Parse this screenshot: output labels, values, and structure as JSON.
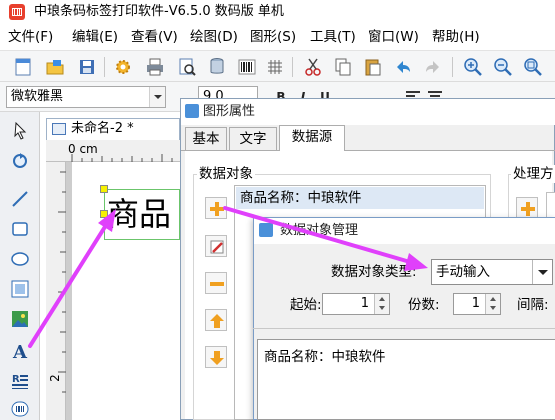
{
  "window": {
    "title": "中琅条码标签打印软件-V6.5.0 数码版 单机"
  },
  "menu": [
    "文件(F)",
    "编辑(E)",
    "查看(V)",
    "绘图(D)",
    "图形(S)",
    "工具(T)",
    "窗口(W)",
    "帮助(H)"
  ],
  "toolbar": {
    "icons": [
      "new-icon",
      "open-icon",
      "save-icon",
      "settings-icon",
      "print-icon",
      "print-preview-icon",
      "database-icon",
      "barcode-icon",
      "grid-icon",
      "cut-icon",
      "copy-icon",
      "paste-icon",
      "undo-icon",
      "redo-icon",
      "zoom-in-icon",
      "zoom-out-icon",
      "zoom-fit-icon"
    ]
  },
  "format": {
    "font_name": "微软雅黑",
    "font_size": "9.0",
    "bold": "B",
    "italic": "I",
    "underline": "U"
  },
  "document": {
    "tab_title": "未命名-2 *",
    "ruler_h_label": "0 cm",
    "ruler_v_label": "2",
    "text_object_value": "商品"
  },
  "props_dialog": {
    "title": "图形属性",
    "tabs": [
      "基本",
      "文字",
      "数据源"
    ],
    "active_tab": "数据源",
    "data_object_label": "数据对象",
    "process_label": "处理方",
    "data_list": [
      "商品名称：中琅软件"
    ]
  },
  "mgmt_dialog": {
    "title": "数据对象管理",
    "type_label": "数据对象类型:",
    "type_value": "手动输入",
    "start_label": "起始:",
    "start_value": "1",
    "count_label": "份数:",
    "count_value": "1",
    "interval_label": "间隔:",
    "content": "商品名称：中琅软件"
  },
  "colors": {
    "accent": "#e040fb",
    "selection": "#dde8f5",
    "handle": "#f6f000",
    "text_box_border": "#6bc56b"
  }
}
